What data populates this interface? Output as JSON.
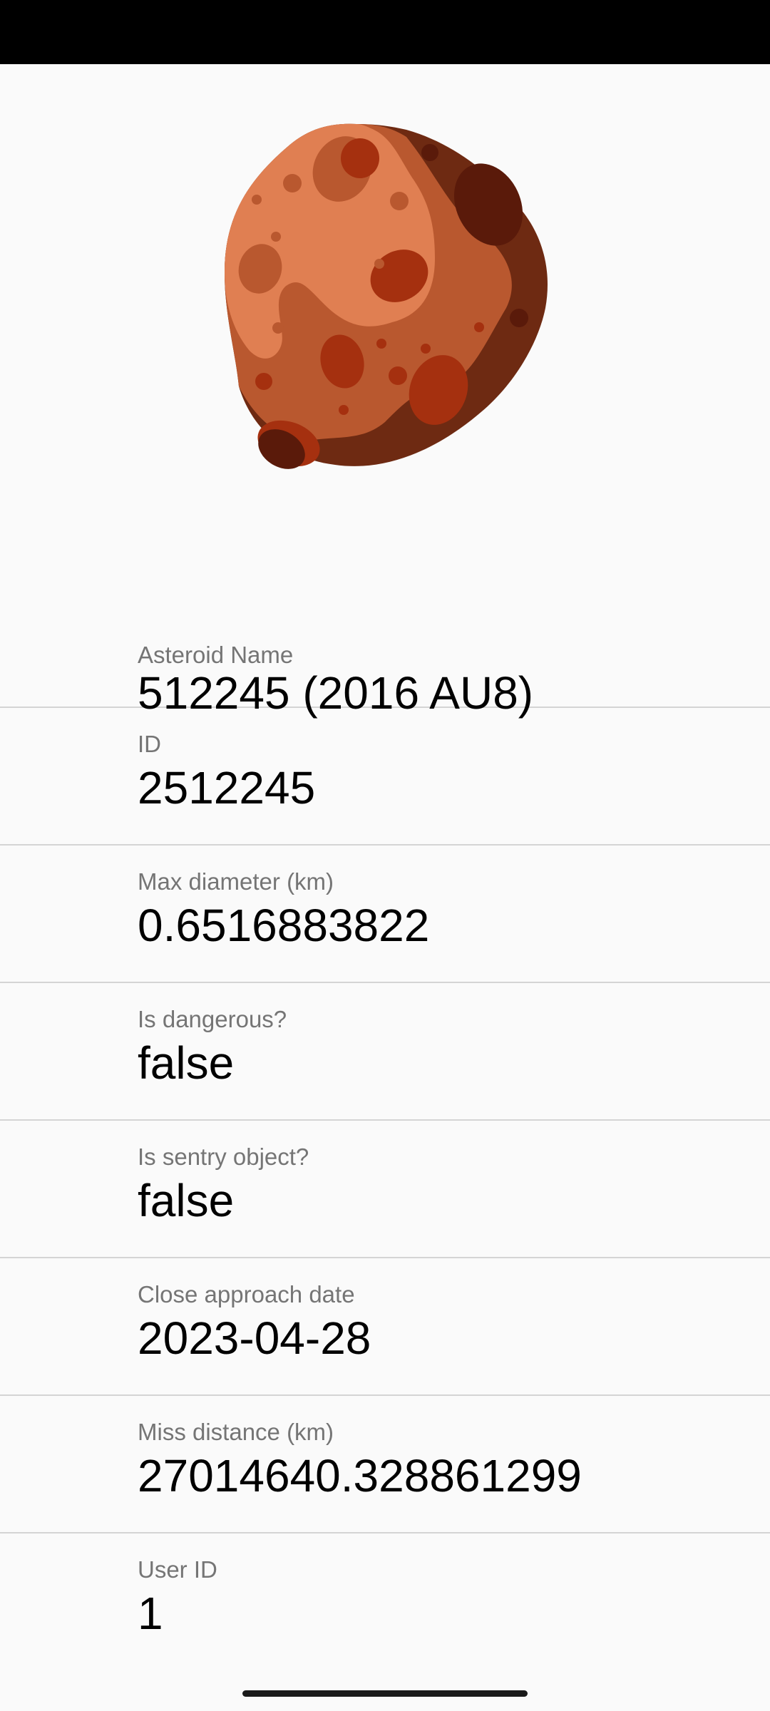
{
  "asteroid_image": {
    "icon": "asteroid-illustration",
    "colors": {
      "light": "#e07f52",
      "mid": "#b9582f",
      "dark": "#6e2a12",
      "crater": "#a5300f",
      "crater_dark": "#5a1a0a"
    }
  },
  "fields": [
    {
      "label": "Asteroid Name",
      "value": "512245 (2016 AU8)"
    },
    {
      "label": "ID",
      "value": "2512245"
    },
    {
      "label": "Max diameter (km)",
      "value": "0.6516883822"
    },
    {
      "label": "Is dangerous?",
      "value": "false"
    },
    {
      "label": "Is sentry object?",
      "value": "false"
    },
    {
      "label": "Close approach date",
      "value": "2023-04-28"
    },
    {
      "label": "Miss distance (km)",
      "value": "27014640.328861299"
    },
    {
      "label": "User ID",
      "value": "1"
    }
  ],
  "colors": {
    "background": "#fafafa",
    "status_bar": "#000000",
    "label_text": "#757575",
    "value_text": "#000000",
    "divider": "#d4d4d4"
  }
}
